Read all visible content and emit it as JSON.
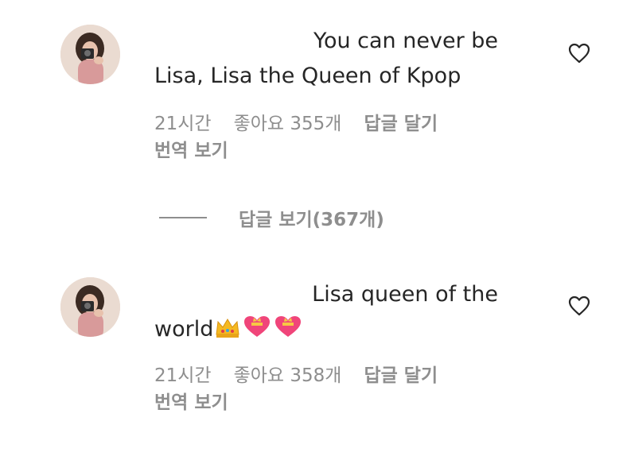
{
  "comments": [
    {
      "text_line1": "You can never be",
      "text_line2": "Lisa, Lisa the Queen of Kpop",
      "time": "21시간",
      "likes": "좋아요 355개",
      "reply_label": "답글 달기",
      "translate_label": "번역 보기",
      "icons": {
        "avatar": "avatar",
        "like": "heart-outline-icon"
      }
    },
    {
      "text_line1": "Lisa queen of the",
      "text_line2": "world",
      "emojis": [
        "crown-emoji",
        "heart-ribbon-emoji",
        "heart-ribbon-emoji"
      ],
      "time": "21시간",
      "likes": "좋아요 358개",
      "reply_label": "답글 달기",
      "translate_label": "번역 보기",
      "icons": {
        "avatar": "avatar",
        "like": "heart-outline-icon"
      }
    }
  ],
  "view_replies_label": "답글 보기(367개)",
  "colors": {
    "text": "#262626",
    "secondary": "#8e8e8e",
    "background": "#ffffff"
  }
}
